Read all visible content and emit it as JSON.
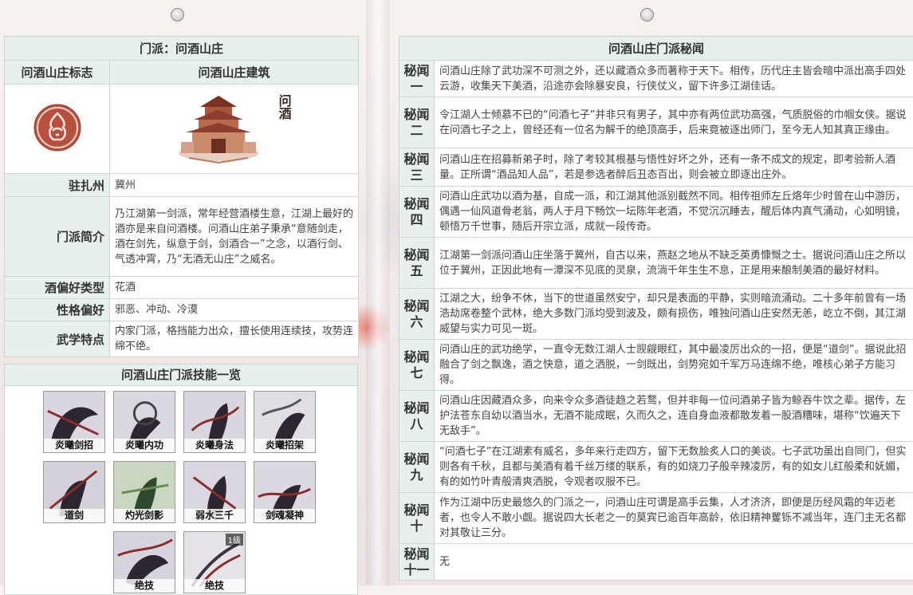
{
  "left": {
    "title": "门派：问酒山庄",
    "col_logo": "问酒山庄标志",
    "col_building": "问酒山庄建筑",
    "building_sign": "问酒",
    "rows": [
      {
        "label": "驻扎州",
        "value": "冀州"
      },
      {
        "label": "门派简介",
        "value": "乃江湖第一剑派，常年经营酒楼生意，江湖上最好的酒亦是来自问酒楼。问酒山庄弟子秉承“意随剑走，酒在剑先，纵意于剑，剑酒合一”之念，以酒行剑、气透冲霄，乃“无酒无山庄”之威名。"
      },
      {
        "label": "酒偏好类型",
        "value": "花酒"
      },
      {
        "label": "性格偏好",
        "value": "邪恶、冲动、冷漠"
      },
      {
        "label": "武学特点",
        "value": "内家门派，格挡能力出众，擅长使用连续技，攻势连绵不绝。"
      }
    ]
  },
  "skills": {
    "title": "问酒山庄门派技能一览",
    "items": [
      {
        "name": "炎曦剑招"
      },
      {
        "name": "炎曦内功"
      },
      {
        "name": "炎曦身法"
      },
      {
        "name": "炎曦招架"
      },
      {
        "name": "道剑"
      },
      {
        "name": "灼光剑影"
      },
      {
        "name": "弱水三千"
      },
      {
        "name": "剑魂凝神"
      },
      {
        "name": "绝技"
      },
      {
        "name": "绝技"
      }
    ],
    "tag": "1级"
  },
  "right": {
    "title": "问酒山庄门派秘闻",
    "rows": [
      {
        "label": "秘闻一",
        "value": "问酒山庄除了武功深不可测之外，还以藏酒众多而著称于天下。相传，历代庄主皆会暗中派出高手四处云游，收集天下美酒，沿途亦会除暴安良，行侠仗义，留下许多江湖佳话。"
      },
      {
        "label": "秘闻二",
        "value": "令江湖人士倾慕不已的“问酒七子”并非只有男子，其中亦有两位武功高强，气质脱俗的巾帼女侠。据说在问酒七子之上，曾经还有一位名为解千的绝顶高手，后来竟被逐出师门，至今无人知其真正缘由。"
      },
      {
        "label": "秘闻三",
        "value": "问酒山庄在招募新弟子时，除了考较其根基与悟性好坏之外，还有一条不成文的规定，即考验新人酒量。正所谓“酒品知人品”，若是参选者醉后丑态百出，则会被立即逐出庄外。"
      },
      {
        "label": "秘闻四",
        "value": "问酒山庄武功以酒为基，自成一派，和江湖其他派别截然不同。相传祖师左丘烙年少时曾在山中游历，偶遇一仙风道骨老翁，两人于月下畅饮一坛陈年老酒，不觉沉沉睡去，醒后体内真气涌动，心如明镜，顿悟万千世事，随后开宗立派，成就一段传奇。"
      },
      {
        "label": "秘闻五",
        "value": "江湖第一剑派问酒山庄坐落于冀州，自古以来，燕赵之地从不缺乏英勇慷慨之士。据说问酒山庄之所以位于冀州，正因此地有一潭深不见底的灵泉，流淌千年生生不息，正是用来酿制美酒的最好材料。"
      },
      {
        "label": "秘闻六",
        "value": "江湖之大，纷争不休，当下的世道虽然安宁，却只是表面的平静，实则暗流涌动。二十多年前曾有一场浩劫席卷整个武林，绝大多数门派均受到波及，颇有损伤，唯独问酒山庄安然无恙，屹立不倒，其江湖威望与实力可见一斑。"
      },
      {
        "label": "秘闻七",
        "value": "问酒山庄的武功绝学，一直令无数江湖人士觊觎眼红，其中最凌厉出众的一招，便是“道剑”。据说此招融合了剑之飘逸，酒之快意，道之洒脱，一剑既出，剑势宛如千军万马连绵不绝，唯核心弟子方能习得。"
      },
      {
        "label": "秘闻八",
        "value": "问酒山庄因藏酒众多，向来令众多酒徒趋之若鹜，但并非每一位问酒弟子皆为鲸吞牛饮之辈。据传，左护法苍东自幼以酒当水，无酒不能成眠，久而久之，连自身血液都散发着一股酒糟味，堪称“饮遍天下无敌手”。"
      },
      {
        "label": "秘闻九",
        "value": "“问酒七子”在江湖素有威名，多年来行走四方，留下无数脍炙人口的美谈。七子武功虽出自同门，但实则各有千秋，且都与美酒有着千丝万缕的联系，有的如烧刀子般辛辣凌厉，有的如女儿红般柔和妩媚，有的如竹叶青般清爽洒脱，令观者叹服不已。"
      },
      {
        "label": "秘闻十",
        "value": "作为江湖中历史最悠久的门派之一，问酒山庄可谓是高手云集，人才济济，即便是历经风霜的年迈老者，也令人不敢小觑。据说四大长老之一的莫宾已逾百年高龄，依旧精神矍铄不减当年，连门主无名都对其敬让三分。"
      },
      {
        "label": "秘闻十一",
        "value": "无"
      }
    ]
  }
}
